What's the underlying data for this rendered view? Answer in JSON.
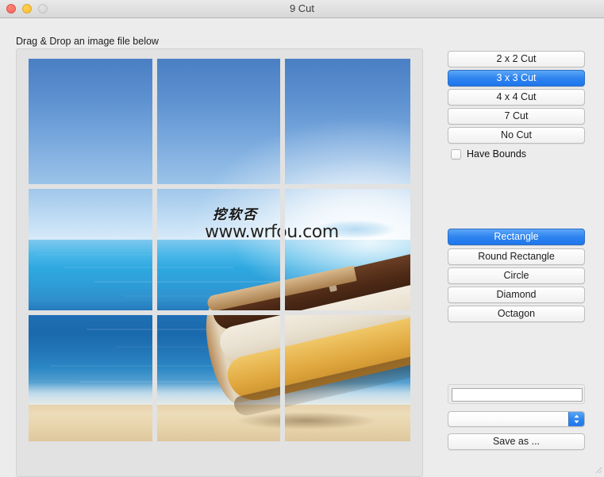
{
  "window": {
    "title": "9 Cut",
    "traffic_lights": [
      {
        "name": "close",
        "color": "#ee6a5f"
      },
      {
        "name": "minimize",
        "color": "#f6bd3b"
      },
      {
        "name": "zoom",
        "color": "#d2d2d2"
      }
    ]
  },
  "main": {
    "drop_hint": "Drag & Drop an image file below"
  },
  "image_preview": {
    "grid": "3 x 3",
    "rows": 3,
    "columns": 3,
    "tile_count": 9,
    "scene": "beach with wooden boat, blue sea and sky",
    "watermark_cn": "挖软否",
    "watermark_url": "www.wrfou.com"
  },
  "cut_options": [
    {
      "label": "2 x 2 Cut",
      "selected": false
    },
    {
      "label": "3 x 3 Cut",
      "selected": true
    },
    {
      "label": "4 x 4 Cut",
      "selected": false
    },
    {
      "label": "7 Cut",
      "selected": false
    },
    {
      "label": "No Cut",
      "selected": false
    }
  ],
  "bounds": {
    "label": "Have Bounds",
    "checked": false
  },
  "shape_options": [
    {
      "label": "Rectangle",
      "selected": true
    },
    {
      "label": "Round Rectangle",
      "selected": false
    },
    {
      "label": "Circle",
      "selected": false
    },
    {
      "label": "Diamond",
      "selected": false
    },
    {
      "label": "Octagon",
      "selected": false
    }
  ],
  "output": {
    "name_field_value": "",
    "name_field_placeholder": "",
    "format_select_value": "",
    "save_button_label": "Save as ..."
  },
  "colors": {
    "accent": "#2f84ef",
    "window_bg": "#ececec",
    "button_border": "#bdbdbd"
  }
}
